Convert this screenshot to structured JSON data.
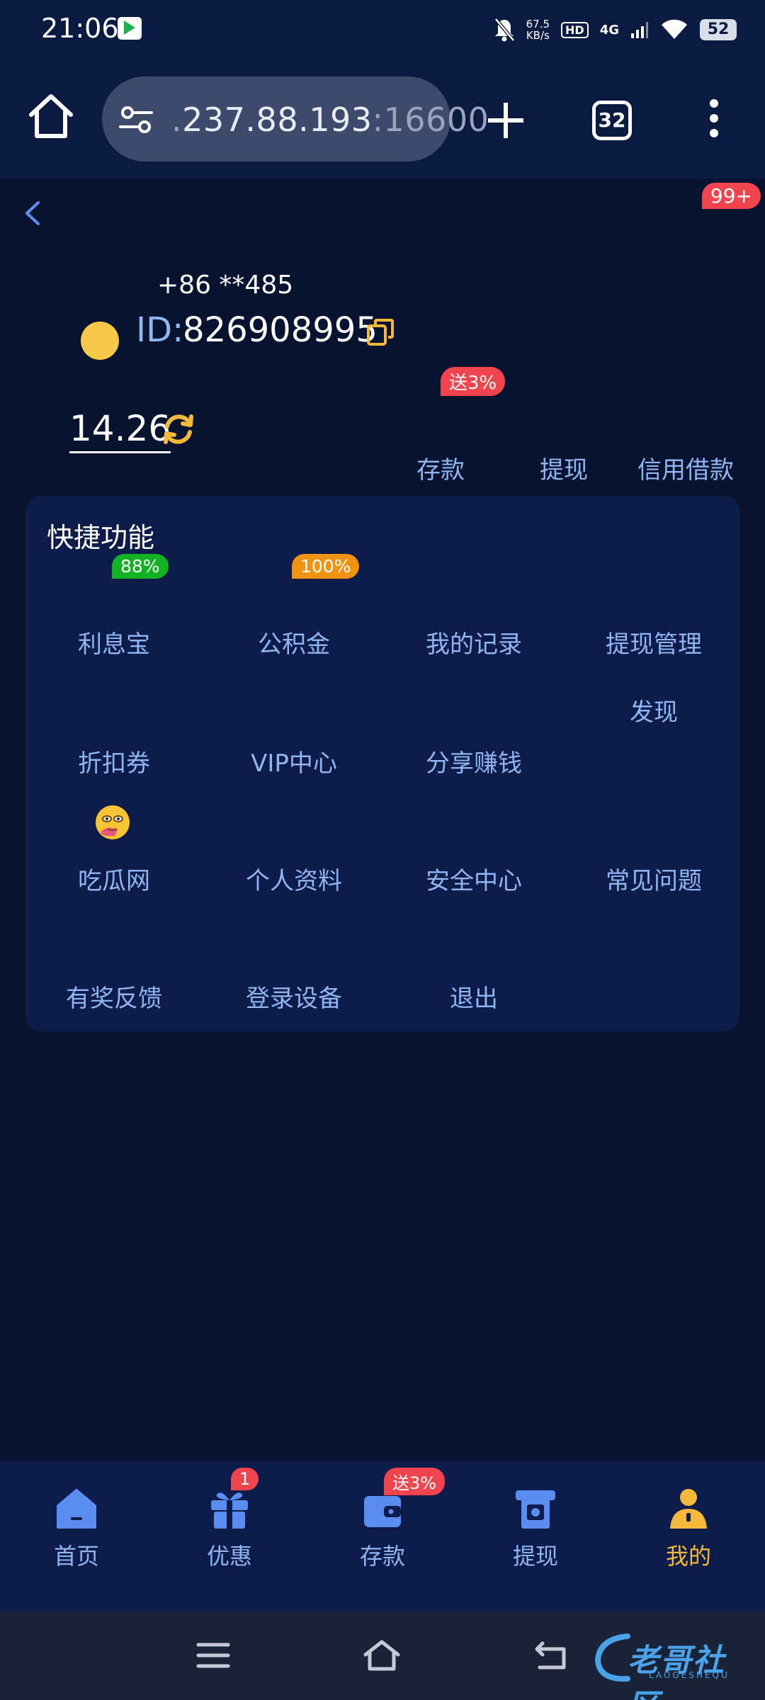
{
  "status_bar": {
    "time": "21:06",
    "net_speed_value": "67.5",
    "net_speed_unit": "KB/s",
    "hd_label": "HD",
    "network_type": "4G",
    "battery": "52"
  },
  "browser": {
    "url_prefix": ".",
    "url_host": "237.88.193",
    "url_port": ":16600",
    "tab_count": "32"
  },
  "header": {
    "notification_badge": "99+"
  },
  "profile": {
    "phone": "+86 **485",
    "id_label": "ID:",
    "id_value": "826908995",
    "balance": "14.26"
  },
  "quick_links": {
    "deposit": "存款",
    "withdraw": "提现",
    "credit_loan": "信用借款",
    "deposit_promo": "送3%"
  },
  "shortcuts": {
    "title": "快捷功能",
    "items": {
      "interest_treasure": "利息宝",
      "interest_badge": "88%",
      "provident_fund": "公积金",
      "provident_badge": "100%",
      "my_records": "我的记录",
      "withdraw_manage": "提现管理",
      "discover": "发现",
      "coupons": "折扣券",
      "vip_center": "VIP中心",
      "share_earn": "分享赚钱",
      "gossip": "吃瓜网",
      "profile": "个人资料",
      "security": "安全中心",
      "faq": "常见问题",
      "feedback": "有奖反馈",
      "login_devices": "登录设备",
      "logout": "退出"
    }
  },
  "bottom_nav": {
    "home": "首页",
    "offers": "优惠",
    "offers_badge": "1",
    "deposit": "存款",
    "deposit_badge": "送3%",
    "withdraw": "提现",
    "mine": "我的"
  },
  "watermark": {
    "text": "老哥社区",
    "sub": "LAOGESHEQU"
  },
  "colors": {
    "background": "#08132f",
    "card": "#0e1c4a",
    "accent_text": "#8fb5f2",
    "active_nav": "#f4b83a",
    "badge_red": "#f0444f"
  }
}
